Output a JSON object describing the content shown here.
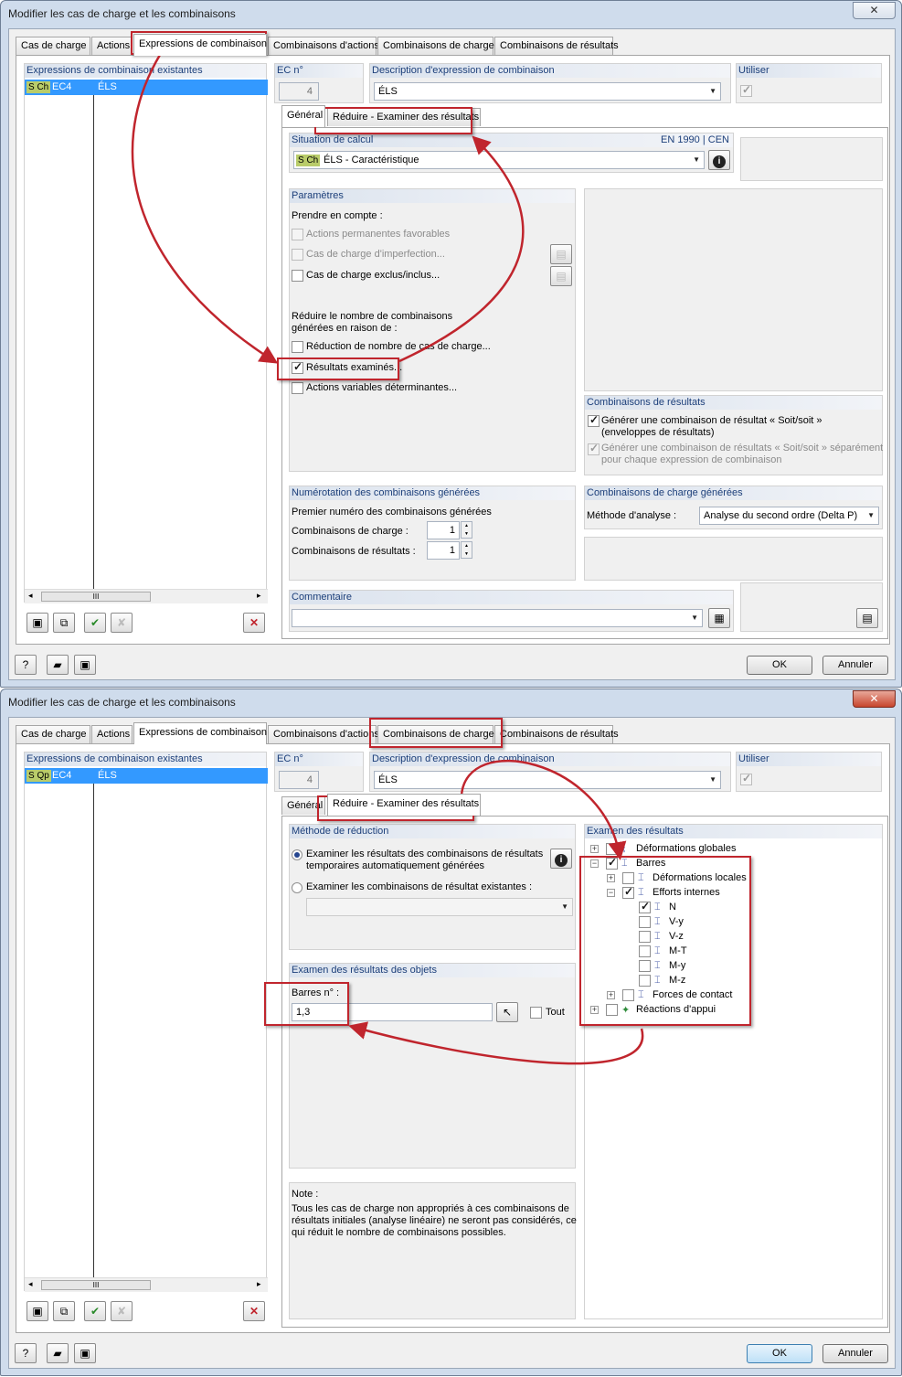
{
  "window1": {
    "title": "Modifier les cas de charge et les combinaisons",
    "tabs": [
      "Cas de charge",
      "Actions",
      "Expressions de combinaison",
      "Combinaisons d'actions",
      "Combinaisons de charge",
      "Combinaisons de résultats"
    ],
    "list_header": "Expressions de combinaison existantes",
    "list_item": {
      "badge": "S Ch",
      "code": "EC4",
      "desc": "ÉLS"
    },
    "ec_label": "EC n°",
    "ec_value": "4",
    "desc_label": "Description d'expression de combinaison",
    "desc_value": "ÉLS",
    "use_label": "Utiliser",
    "subtabs": [
      "Général",
      "Réduire - Examiner des résultats"
    ],
    "situation": {
      "header": "Situation de calcul",
      "norm": "EN 1990 | CEN",
      "badge": "S Ch",
      "value": "ÉLS - Caractéristique"
    },
    "params": {
      "header": "Paramètres",
      "consider": "Prendre en compte :",
      "opt1": "Actions permanentes favorables",
      "opt2": "Cas de charge d'imperfection...",
      "opt3": "Cas de charge exclus/inclus...",
      "reduce_l1": "Réduire le nombre de combinaisons",
      "reduce_l2": "générées en raison de :",
      "opt4": "Réduction de nombre de cas de charge...",
      "opt5": "Résultats examinés...",
      "opt6": "Actions variables déterminantes..."
    },
    "result_combos": {
      "header": "Combinaisons de résultats",
      "opt1_l1": "Générer une combinaison de résultat « Soit/soit »",
      "opt1_l2": "(enveloppes de résultats)",
      "opt2_l1": "Générer une combinaison de résultats « Soit/soit » séparément",
      "opt2_l2": "pour chaque expression de combinaison"
    },
    "numbering": {
      "header": "Numérotation des combinaisons générées",
      "first": "Premier numéro des combinaisons générées",
      "lc_label": "Combinaisons de charge :",
      "lc_value": "1",
      "rc_label": "Combinaisons de résultats :",
      "rc_value": "1"
    },
    "generated": {
      "header": "Combinaisons de charge générées",
      "method_label": "Méthode d'analyse :",
      "method_value": "Analyse du second ordre (Delta P)"
    },
    "comment_header": "Commentaire",
    "scroll_mark": "III",
    "ok": "OK",
    "cancel": "Annuler"
  },
  "window2": {
    "title": "Modifier les cas de charge et les combinaisons",
    "tabs": [
      "Cas de charge",
      "Actions",
      "Expressions de combinaison",
      "Combinaisons d'actions",
      "Combinaisons de charge",
      "Combinaisons de résultats"
    ],
    "list_header": "Expressions de combinaison existantes",
    "list_item": {
      "badge": "S Qp",
      "code": "EC4",
      "desc": "ÉLS"
    },
    "ec_label": "EC n°",
    "ec_value": "4",
    "desc_label": "Description d'expression de combinaison",
    "desc_value": "ÉLS",
    "use_label": "Utiliser",
    "subtabs": [
      "Général",
      "Réduire - Examiner des résultats"
    ],
    "method": {
      "header": "Méthode de réduction",
      "opt1_l1": "Examiner les résultats des combinaisons de résultats",
      "opt1_l2": "temporaires automatiquement générées",
      "opt2": "Examiner les combinaisons de résultat existantes :"
    },
    "objects": {
      "header": "Examen des résultats des objets",
      "bars_label": "Barres n° :",
      "bars_value": "1,3",
      "all_label": "Tout"
    },
    "note": {
      "title": "Note :",
      "l1": "Tous les cas de charge non appropriés à ces combinaisons de",
      "l2": "résultats initiales (analyse linéaire) ne seront pas considérés, ce",
      "l3": "qui réduit le nombre de combinaisons possibles."
    },
    "examine": {
      "header": "Examen des résultats",
      "items": [
        "Déformations globales",
        "Barres",
        "Déformations locales",
        "Efforts internes",
        "N",
        "V-y",
        "V-z",
        "M-T",
        "M-y",
        "M-z",
        "Forces de contact",
        "Réactions d'appui"
      ]
    },
    "scroll_mark": "III",
    "ok": "OK",
    "cancel": "Annuler"
  }
}
